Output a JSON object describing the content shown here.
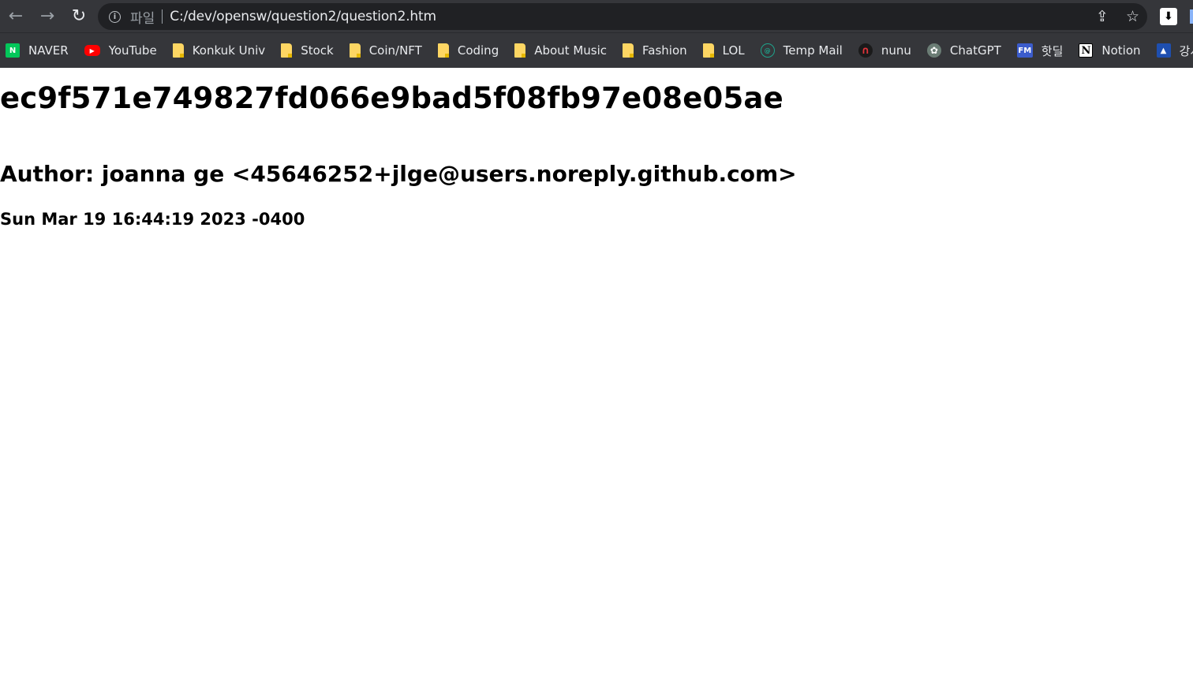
{
  "browser": {
    "toolbar": {
      "back_icon": "←",
      "forward_icon": "→",
      "reload_icon": "↻",
      "omnibox": {
        "info_icon": "i",
        "scheme_label": "파일",
        "url": "C:/dev/opensw/question2/question2.htm",
        "share_icon": "⇪",
        "star_icon": "☆"
      },
      "extension_icon": "⬇"
    },
    "bookmarks": [
      {
        "label": "NAVER",
        "icon": "naver-icon",
        "glyph": "N"
      },
      {
        "label": "YouTube",
        "icon": "youtube-icon",
        "glyph": "▶"
      },
      {
        "label": "Konkuk Univ",
        "icon": "folder-icon",
        "glyph": ""
      },
      {
        "label": "Stock",
        "icon": "folder-icon",
        "glyph": ""
      },
      {
        "label": "Coin/NFT",
        "icon": "folder-icon",
        "glyph": ""
      },
      {
        "label": "Coding",
        "icon": "folder-icon",
        "glyph": ""
      },
      {
        "label": "About Music",
        "icon": "folder-icon",
        "glyph": ""
      },
      {
        "label": "Fashion",
        "icon": "folder-icon",
        "glyph": ""
      },
      {
        "label": "LOL",
        "icon": "folder-icon",
        "glyph": ""
      },
      {
        "label": "Temp Mail",
        "icon": "temp-mail-icon",
        "glyph": "@"
      },
      {
        "label": "nunu",
        "icon": "nunu-icon",
        "glyph": "∩"
      },
      {
        "label": "ChatGPT",
        "icon": "chatgpt-icon",
        "glyph": "✿"
      },
      {
        "label": "핫딜",
        "icon": "fm-icon",
        "glyph": "FM"
      },
      {
        "label": "Notion",
        "icon": "notion-icon",
        "glyph": "N"
      },
      {
        "label": "강서",
        "icon": "lecture-icon",
        "glyph": "▲"
      }
    ]
  },
  "page": {
    "commit_hash": "ec9f571e749827fd066e9bad5f08fb97e08e05ae",
    "author_line": "Author: joanna ge <45646252+jlge@users.noreply.github.com>",
    "date_line": "Sun Mar 19 16:44:19 2023 -0400"
  }
}
